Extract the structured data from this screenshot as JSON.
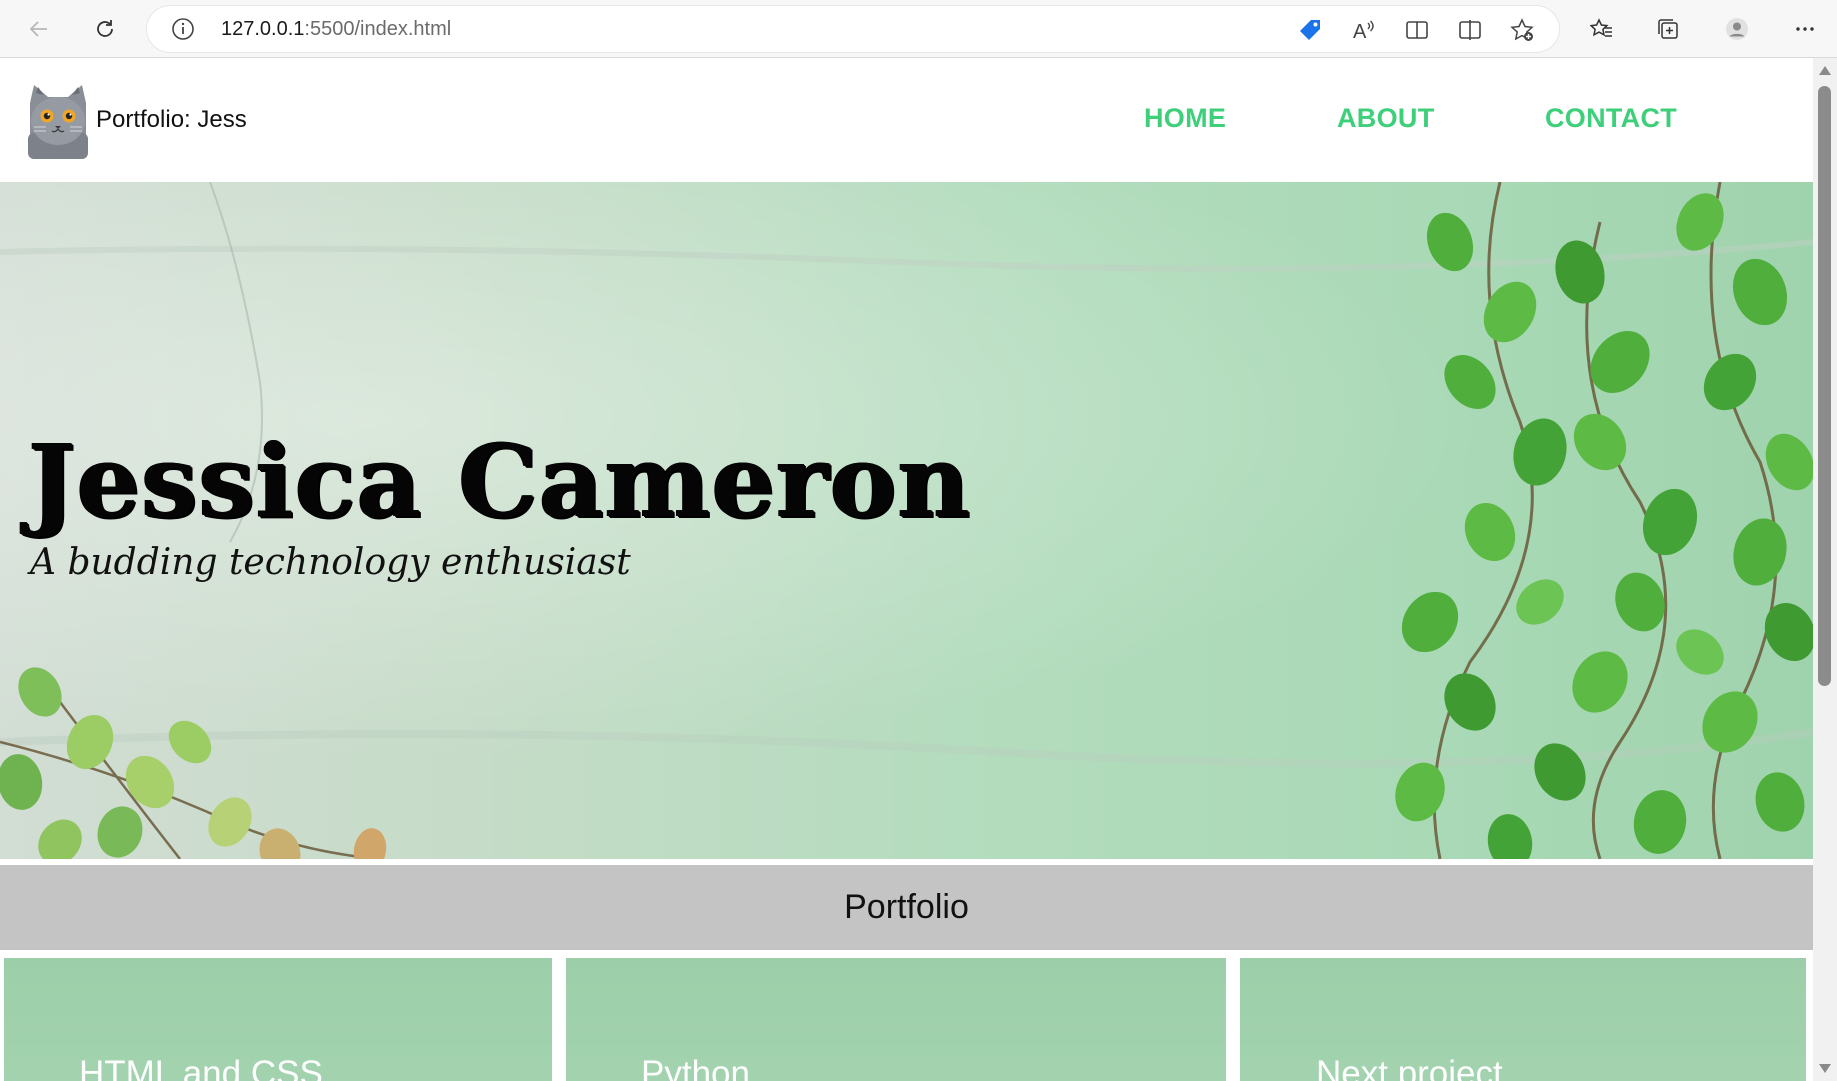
{
  "browser": {
    "url_host": "127.0.0.1",
    "url_rest": ":5500/index.html",
    "toolbar_icons": [
      "back-icon",
      "refresh-icon",
      "info-icon",
      "tag-icon",
      "read-aloud-icon",
      "immersive-reader-icon",
      "split-screen-icon",
      "add-favorite-icon",
      "favorites-icon",
      "collections-icon",
      "profile-icon",
      "more-icon"
    ]
  },
  "site": {
    "title": "Portfolio: Jess",
    "nav": [
      {
        "label": "HOME"
      },
      {
        "label": "ABOUT"
      },
      {
        "label": "CONTACT"
      }
    ],
    "accent": "#3ecf7a"
  },
  "hero": {
    "name": "Jessica Cameron",
    "tagline": "A budding technology enthusiast"
  },
  "portfolio": {
    "heading": "Portfolio",
    "cards": [
      {
        "title": "HTML and CSS"
      },
      {
        "title": "Python"
      },
      {
        "title": "Next project"
      }
    ]
  }
}
